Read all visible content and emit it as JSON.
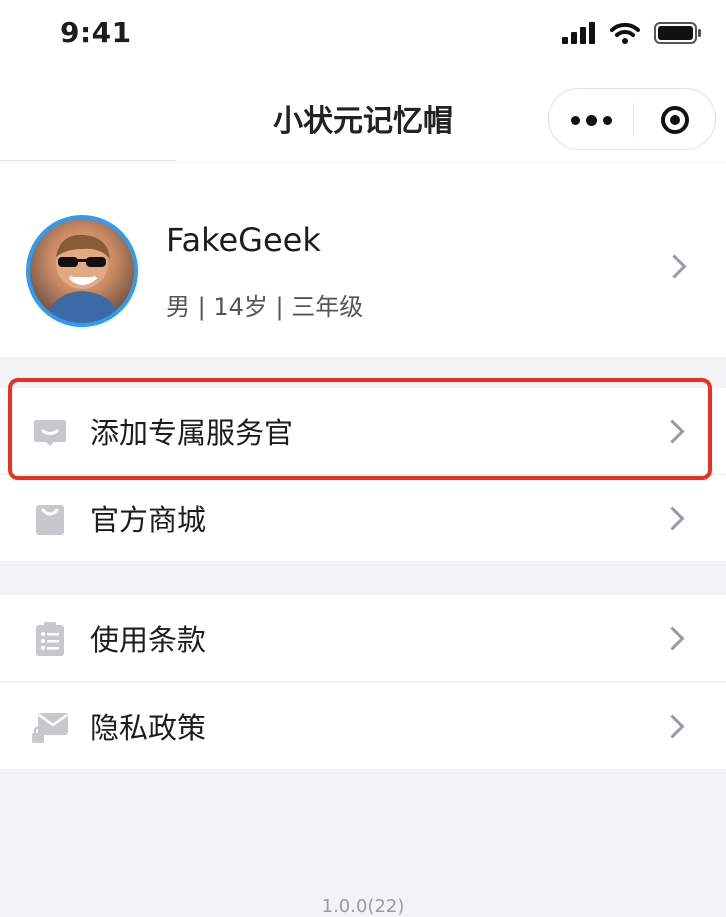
{
  "status_bar": {
    "time": "9:41",
    "icons": [
      "signal-icon",
      "wifi-icon",
      "battery-icon"
    ]
  },
  "nav": {
    "title": "小状元记忆帽",
    "more_icon": "more-dots-icon",
    "close_icon": "target-close-icon"
  },
  "profile": {
    "name": "FakeGeek",
    "info": "男 | 14岁 | 三年级",
    "avatar_ring_color": "#2f9cf0"
  },
  "menu": {
    "group1": [
      {
        "label": "添加专属服务官",
        "icon": "message-bubble-icon"
      },
      {
        "label": "官方商城",
        "icon": "shopping-bag-icon"
      }
    ],
    "group2": [
      {
        "label": "使用条款",
        "icon": "clipboard-list-icon"
      },
      {
        "label": "隐私政策",
        "icon": "envelope-lock-icon"
      }
    ]
  },
  "highlight_color": "#e8321f",
  "version": "1.0.0(22)"
}
